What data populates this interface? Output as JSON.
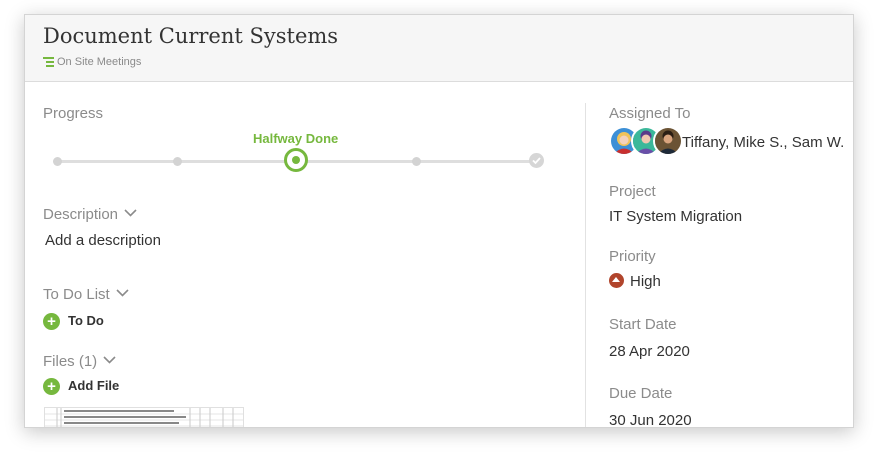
{
  "header": {
    "title": "Document Current Systems",
    "breadcrumb": "On Site Meetings",
    "breadcrumb_icon": "list-icon"
  },
  "progress": {
    "label": "Progress",
    "status": "Halfway Done",
    "current_step": 3,
    "total_steps": 5,
    "accent_color": "#76b83e"
  },
  "description": {
    "label": "Description",
    "value": "Add a description"
  },
  "todo": {
    "label": "To Do List",
    "add_label": "To Do"
  },
  "files": {
    "label": "Files (1)",
    "add_label": "Add File"
  },
  "assigned": {
    "label": "Assigned To",
    "names": "Tiffany, Mike S., Sam W."
  },
  "project": {
    "label": "Project",
    "value": "IT System Migration"
  },
  "priority": {
    "label": "Priority",
    "value": "High",
    "color": "#b1452c"
  },
  "start_date": {
    "label": "Start Date",
    "value": "28 Apr 2020"
  },
  "due_date": {
    "label": "Due Date",
    "value": "30 Jun 2020"
  }
}
